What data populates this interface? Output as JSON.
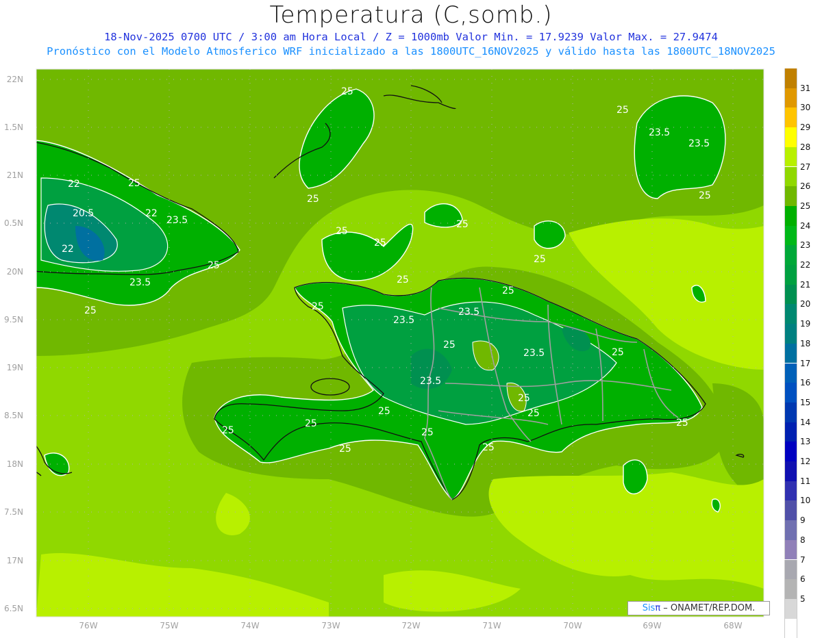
{
  "header": {
    "title": "Temperatura (C,somb.)",
    "subtitle_line1": "18-Nov-2025  0700 UTC / 3:00 am Hora Local / Z = 1000mb   Valor Min. = 17.9239  Valor Max. = 27.9474",
    "subtitle_line2": "Pronóstico con el Modelo Atmosferico WRF inicializado a las 1800UTC_16NOV2025 y válido hasta las  1800UTC_18NOV2025"
  },
  "map": {
    "lat_labels": [
      "22N",
      "1.5N",
      "21N",
      "0.5N",
      "20N",
      "9.5N",
      "19N",
      "8.5N",
      "18N",
      "7.5N",
      "17N",
      "6.5N"
    ],
    "lon_labels": [
      "76W",
      "75W",
      "74W",
      "73W",
      "72W",
      "71W",
      "70W",
      "69W",
      "68W"
    ],
    "contour_labels": [
      "25",
      "25",
      "23.5",
      "23.5",
      "25",
      "25",
      "22",
      "25",
      "20.5",
      "22",
      "23.5",
      "25",
      "25",
      "25",
      "22",
      "25",
      "25",
      "25",
      "23.5",
      "25",
      "25",
      "25",
      "23.5",
      "23.5",
      "25",
      "23.5",
      "25",
      "23.5",
      "25",
      "25",
      "25",
      "25",
      "25",
      "25",
      "25",
      "25",
      "25"
    ],
    "colors": {
      "ocean_base": "#90d800",
      "ocean_dark": "#70b800",
      "ocean_light": "#b8f000",
      "land": "#00b000",
      "land_inner": "#00a838",
      "cool": "#009060",
      "coast": "#111111",
      "borders": "#a0a0a0",
      "contour": "#ffffff"
    }
  },
  "colorbar": {
    "labels": [
      "31",
      "30",
      "29",
      "28",
      "27",
      "26",
      "25",
      "24",
      "23",
      "22",
      "21",
      "20",
      "19",
      "18",
      "17",
      "16",
      "15",
      "14",
      "13",
      "12",
      "11",
      "10",
      "9",
      "8",
      "7",
      "6",
      "5"
    ],
    "colors": [
      "#c08000",
      "#e09800",
      "#ffc400",
      "#ffff00",
      "#b8f000",
      "#90d800",
      "#70b800",
      "#00b000",
      "#00b818",
      "#00a838",
      "#00a040",
      "#009050",
      "#008870",
      "#008080",
      "#0070a0",
      "#0060b8",
      "#0050c0",
      "#0038b0",
      "#0020b0",
      "#0000c0",
      "#1010b0",
      "#3030b0",
      "#5050a8",
      "#7070b0",
      "#9080b8",
      "#a8a8b0",
      "#b4b4b4",
      "#d8d8d8"
    ],
    "last_color": "#ffffff"
  },
  "credit": {
    "brand_sis": "Sis",
    "brand_pi": "π",
    "text": " – ONAMET/REP.DOM."
  }
}
